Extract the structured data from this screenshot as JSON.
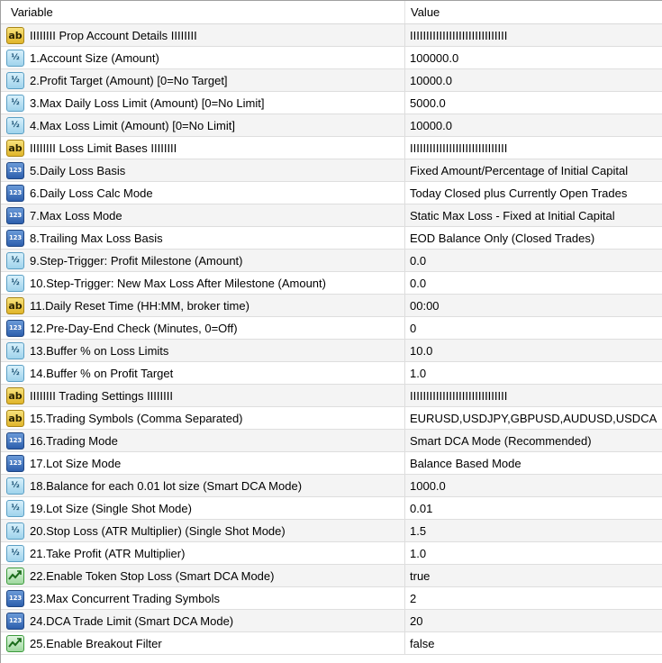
{
  "header": {
    "variable": "Variable",
    "value": "Value"
  },
  "icon_glyphs": {
    "str": "ab",
    "dbl": "½",
    "int": "123",
    "bool": ""
  },
  "rows": [
    {
      "type": "str",
      "variable": "IIIIIIII Prop Account Details IIIIIIII",
      "value": "IIIIIIIIIIIIIIIIIIIIIIIIIIIIII"
    },
    {
      "type": "dbl",
      "variable": "1.Account Size (Amount)",
      "value": "100000.0"
    },
    {
      "type": "dbl",
      "variable": "2.Profit Target (Amount) [0=No Target]",
      "value": "10000.0"
    },
    {
      "type": "dbl",
      "variable": "3.Max Daily Loss Limit (Amount) [0=No Limit]",
      "value": "5000.0"
    },
    {
      "type": "dbl",
      "variable": "4.Max Loss Limit (Amount) [0=No Limit]",
      "value": "10000.0"
    },
    {
      "type": "str",
      "variable": "IIIIIIII Loss Limit Bases IIIIIIII",
      "value": "IIIIIIIIIIIIIIIIIIIIIIIIIIIIII"
    },
    {
      "type": "int",
      "variable": "5.Daily Loss Basis",
      "value": "Fixed Amount/Percentage of Initial Capital"
    },
    {
      "type": "int",
      "variable": "6.Daily Loss Calc Mode",
      "value": "Today Closed plus Currently Open Trades"
    },
    {
      "type": "int",
      "variable": "7.Max Loss Mode",
      "value": "Static Max Loss - Fixed at Initial Capital"
    },
    {
      "type": "int",
      "variable": "8.Trailing Max Loss Basis",
      "value": "EOD Balance Only (Closed Trades)"
    },
    {
      "type": "dbl",
      "variable": "9.Step-Trigger: Profit Milestone (Amount)",
      "value": "0.0"
    },
    {
      "type": "dbl",
      "variable": "10.Step-Trigger: New Max Loss After Milestone (Amount)",
      "value": "0.0"
    },
    {
      "type": "str",
      "variable": "11.Daily Reset Time (HH:MM, broker time)",
      "value": "00:00"
    },
    {
      "type": "int",
      "variable": "12.Pre-Day-End Check (Minutes, 0=Off)",
      "value": "0"
    },
    {
      "type": "dbl",
      "variable": "13.Buffer % on Loss Limits",
      "value": "10.0"
    },
    {
      "type": "dbl",
      "variable": "14.Buffer % on Profit Target",
      "value": "1.0"
    },
    {
      "type": "str",
      "variable": "IIIIIIII Trading Settings IIIIIIII",
      "value": "IIIIIIIIIIIIIIIIIIIIIIIIIIIIII"
    },
    {
      "type": "str",
      "variable": "15.Trading Symbols (Comma Separated)",
      "value": "EURUSD,USDJPY,GBPUSD,AUDUSD,USDCA"
    },
    {
      "type": "int",
      "variable": "16.Trading Mode",
      "value": "Smart DCA Mode (Recommended)"
    },
    {
      "type": "int",
      "variable": "17.Lot Size Mode",
      "value": "Balance Based Mode"
    },
    {
      "type": "dbl",
      "variable": "18.Balance for each 0.01 lot size (Smart DCA Mode)",
      "value": "1000.0"
    },
    {
      "type": "dbl",
      "variable": "19.Lot Size (Single Shot Mode)",
      "value": "0.01"
    },
    {
      "type": "dbl",
      "variable": "20.Stop Loss (ATR Multiplier) (Single Shot Mode)",
      "value": "1.5"
    },
    {
      "type": "dbl",
      "variable": "21.Take Profit (ATR Multiplier)",
      "value": "1.0"
    },
    {
      "type": "bool",
      "variable": "22.Enable Token Stop Loss (Smart DCA Mode)",
      "value": "true"
    },
    {
      "type": "int",
      "variable": "23.Max Concurrent Trading Symbols",
      "value": "2"
    },
    {
      "type": "int",
      "variable": "24.DCA Trade Limit (Smart DCA Mode)",
      "value": "20"
    },
    {
      "type": "bool",
      "variable": "25.Enable Breakout Filter",
      "value": "false"
    }
  ]
}
